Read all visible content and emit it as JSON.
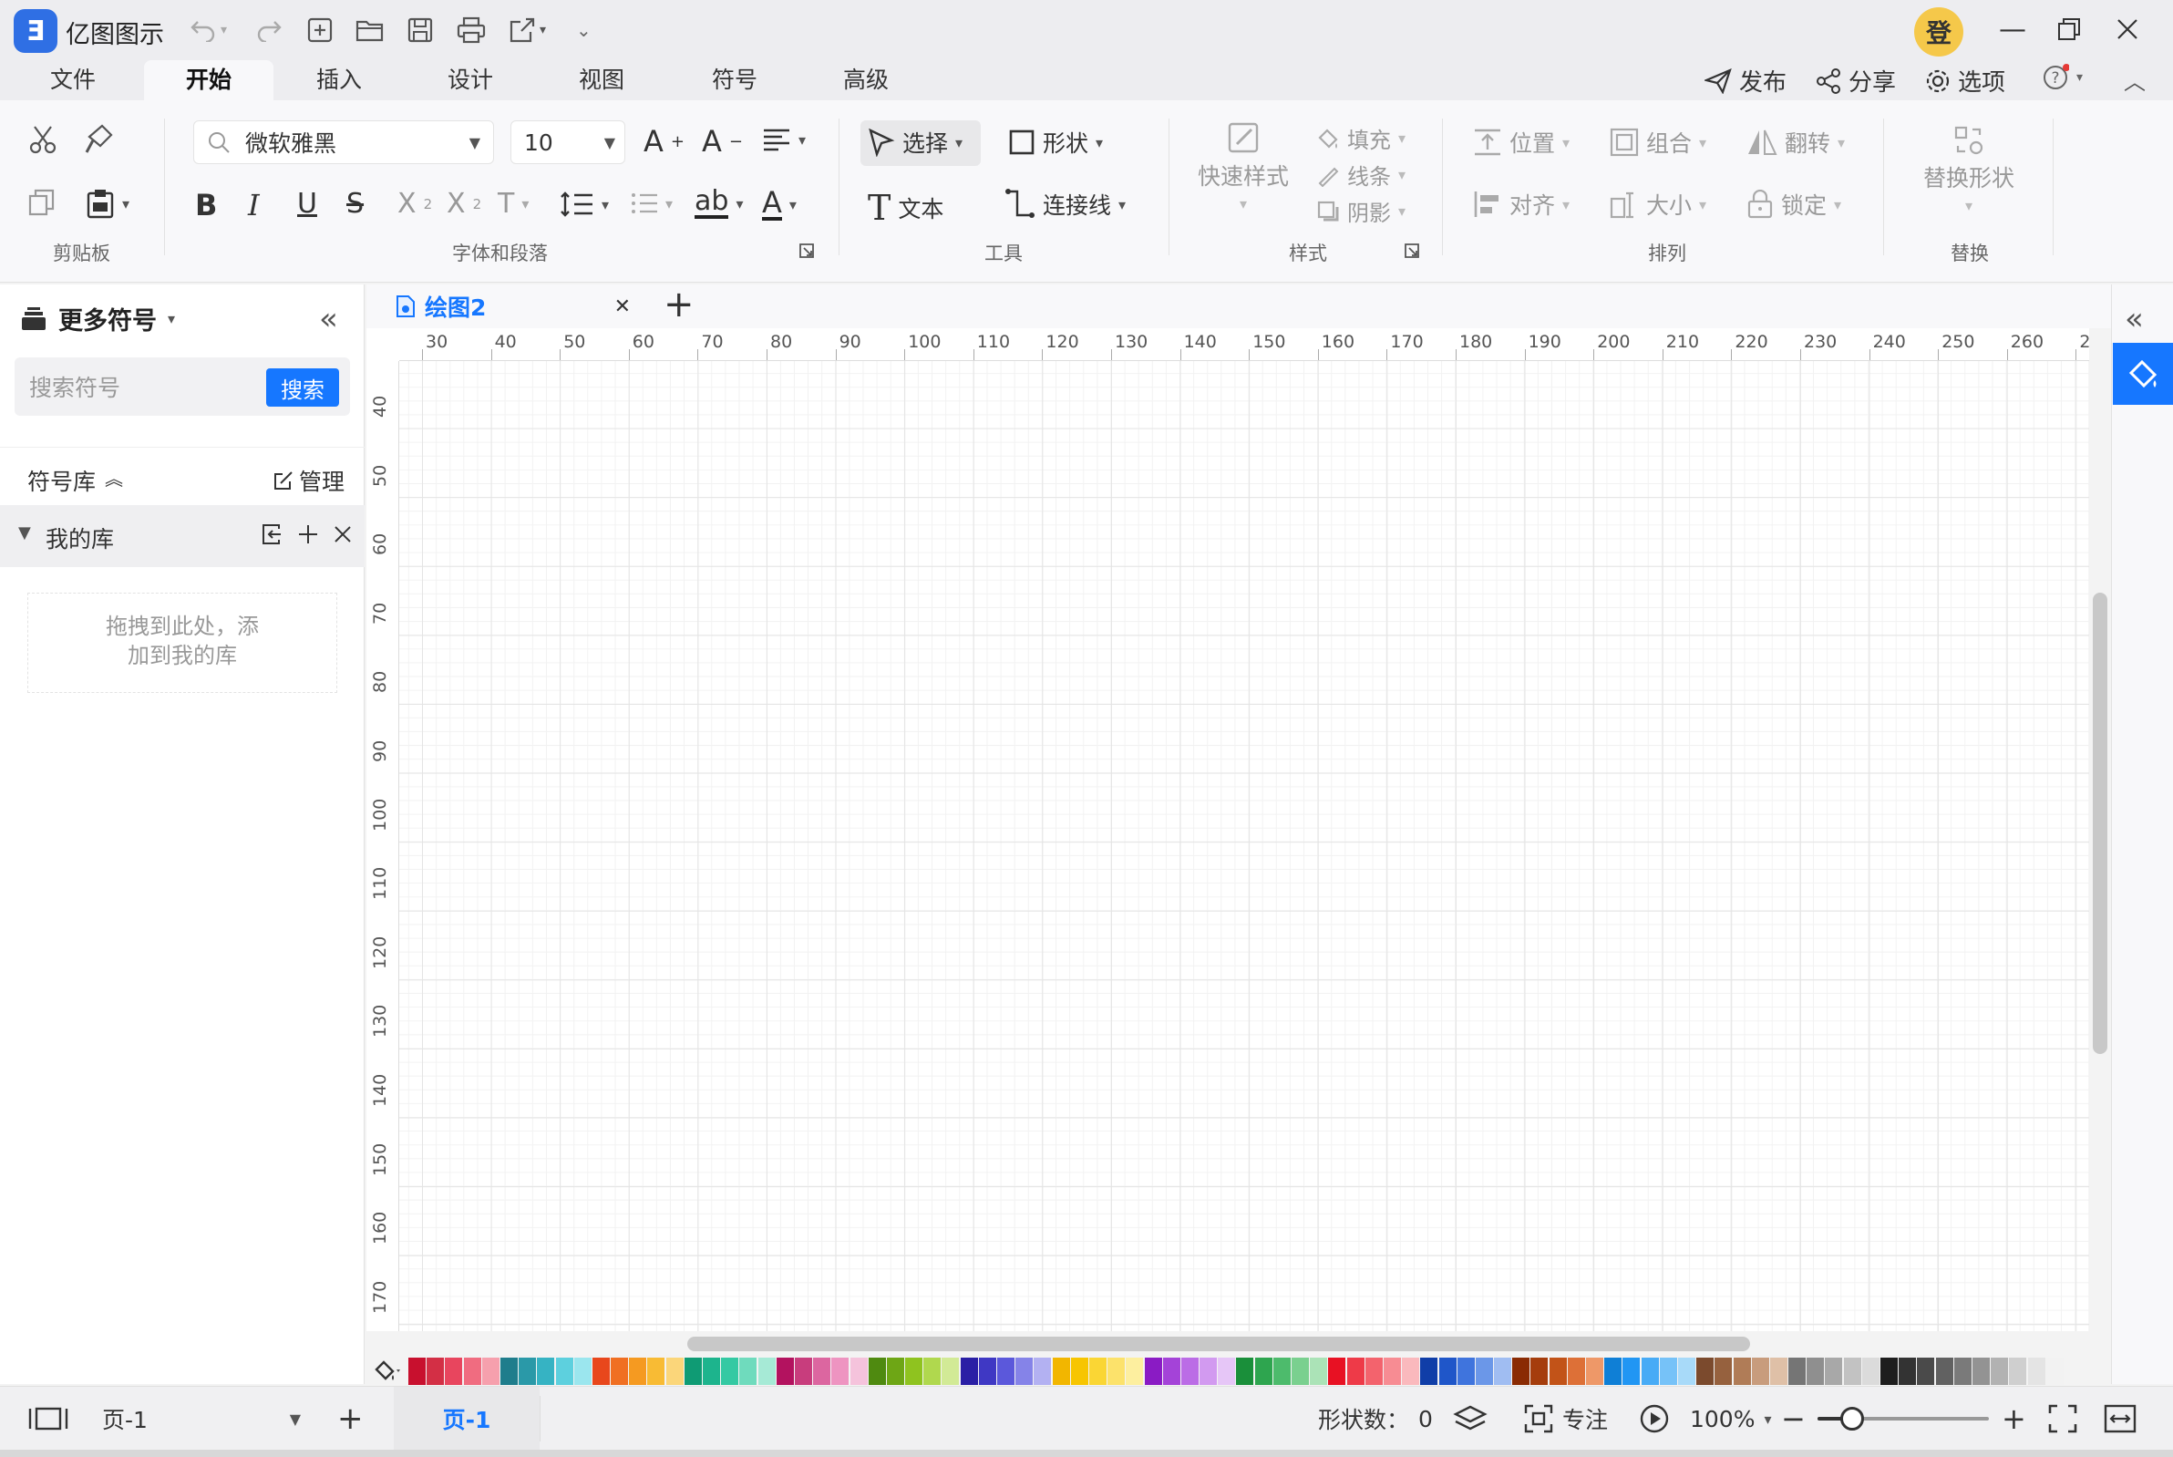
{
  "app": {
    "name": "亿图图示",
    "logo": "Ǝ"
  },
  "avatar": {
    "text": "登"
  },
  "menu_tabs": [
    {
      "label": "文件"
    },
    {
      "label": "开始"
    },
    {
      "label": "插入"
    },
    {
      "label": "设计"
    },
    {
      "label": "视图"
    },
    {
      "label": "符号"
    },
    {
      "label": "高级"
    }
  ],
  "active_tab": "开始",
  "header_actions": {
    "publish": "发布",
    "share": "分享",
    "options": "选项"
  },
  "ribbon": {
    "font_name": "微软雅黑",
    "font_size": "10",
    "select": "选择",
    "shape": "形状",
    "text": "文本",
    "connector": "连接线",
    "quick_style": "快速样式",
    "fill": "填充",
    "line": "线条",
    "shadow": "阴影",
    "position": "位置",
    "group": "组合",
    "flip": "翻转",
    "align": "对齐",
    "size": "大小",
    "lock": "锁定",
    "replace_shape": "替换形状",
    "groups": {
      "clipboard": "剪贴板",
      "font_para": "字体和段落",
      "tools": "工具",
      "style": "样式",
      "arrange": "排列",
      "replace": "替换"
    }
  },
  "left_panel": {
    "title": "更多符号",
    "search_placeholder": "搜索符号",
    "search_button": "搜索",
    "library_label": "符号库",
    "manage": "管理",
    "my_library": "我的库",
    "drop_hint_1": "拖拽到此处，添",
    "drop_hint_2": "加到我的库"
  },
  "document_tab": {
    "name": "绘图2"
  },
  "ruler_top": [
    "30",
    "40",
    "50",
    "60",
    "70",
    "80",
    "90",
    "100",
    "110",
    "120",
    "130",
    "140",
    "150",
    "160",
    "170",
    "180",
    "190",
    "200",
    "210",
    "220",
    "230",
    "240",
    "250",
    "260",
    "2"
  ],
  "ruler_left": [
    "40",
    "50",
    "60",
    "70",
    "80",
    "90",
    "100",
    "110",
    "120",
    "130",
    "140",
    "150",
    "160",
    "170"
  ],
  "palette": [
    "#c8102e",
    "#d32f45",
    "#e8455e",
    "#f06c80",
    "#f6a0ad",
    "#1f7d8c",
    "#2a99a8",
    "#36b3c3",
    "#5dd0de",
    "#9be6ee",
    "#e8471c",
    "#f06f22",
    "#f59a21",
    "#f8bb34",
    "#fbd67a",
    "#0f9b74",
    "#1db48d",
    "#34c9a3",
    "#6fdbbd",
    "#a6ead6",
    "#b3125f",
    "#c83d7d",
    "#dc66a0",
    "#ee94c1",
    "#f5c3dc",
    "#4f8a10",
    "#6ea615",
    "#8fc31f",
    "#b0d84e",
    "#d2ea96",
    "#2a1fa5",
    "#3f38c4",
    "#5b58db",
    "#8583e8",
    "#b3b1f2",
    "#f2b600",
    "#f7c500",
    "#fad634",
    "#fce26b",
    "#fdef9f",
    "#8a1bc4",
    "#a443d8",
    "#bb6ce6",
    "#d29af0",
    "#e6c6f7",
    "#1a8f3a",
    "#2ea54f",
    "#4dbb6c",
    "#7ad08f",
    "#abe3b7",
    "#e81123",
    "#ee3a48",
    "#f3636d",
    "#f78c93",
    "#fab9bd",
    "#103ea8",
    "#1f56c9",
    "#3f74dd",
    "#6b97e8",
    "#a0bdf2",
    "#8a2b04",
    "#a53d0c",
    "#c25318",
    "#dd7037",
    "#ee9868",
    "#0f7fd6",
    "#2196f3",
    "#47abf6",
    "#76c2f8",
    "#a8daf9",
    "#7b4a2d",
    "#96613e",
    "#b07c57",
    "#c89c7d",
    "#dfc0a7",
    "#757575",
    "#8f8f8f",
    "#a8a8a8",
    "#c2c2c2",
    "#dbdbdb",
    "#1e1e1e",
    "#333333",
    "#4a4a4a",
    "#616161",
    "#7a7a7a",
    "#939393",
    "#b2b2b2",
    "#cfcfcf",
    "#e4e4e4",
    "#f2f2f2"
  ],
  "status": {
    "page_selector": "页-1",
    "page_tab": "页-1",
    "shape_count_label": "形状数：",
    "shape_count": "0",
    "focus": "专注",
    "zoom": "100%",
    "zoom_level": 0.2
  },
  "colors": {
    "accent": "#1677ff"
  }
}
